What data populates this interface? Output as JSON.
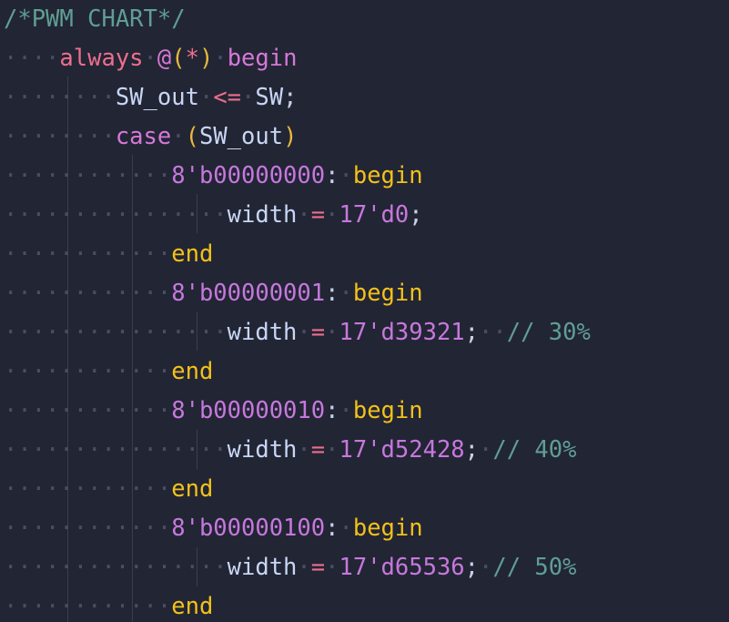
{
  "code": {
    "l1": {
      "comment": "/*PWM CHART*/"
    },
    "l2": {
      "always": "always",
      "at": "@",
      "lp": "(",
      "star": "*",
      "rp": ")",
      "begin": "begin"
    },
    "l3": {
      "lhs": "SW_out",
      "op": "<=",
      "rhs": "SW",
      "semi": ";"
    },
    "l4": {
      "case": "case",
      "lp": "(",
      "arg": "SW_out",
      "rp": ")"
    },
    "cases": [
      {
        "label": "8'b00000000",
        "colon": ":",
        "begin": "begin",
        "var": "width",
        "eq": "=",
        "val": "17'd0",
        "semi": ";",
        "comment": "",
        "end": "end"
      },
      {
        "label": "8'b00000001",
        "colon": ":",
        "begin": "begin",
        "var": "width",
        "eq": "=",
        "val": "17'd39321",
        "semi": ";",
        "comment": "// 30%",
        "end": "end"
      },
      {
        "label": "8'b00000010",
        "colon": ":",
        "begin": "begin",
        "var": "width",
        "eq": "=",
        "val": "17'd52428",
        "semi": ";",
        "comment": "// 40%",
        "end": "end"
      },
      {
        "label": "8'b00000100",
        "colon": ":",
        "begin": "begin",
        "var": "width",
        "eq": "=",
        "val": "17'd65536",
        "semi": ";",
        "comment": "// 50%",
        "end": "end"
      }
    ]
  }
}
